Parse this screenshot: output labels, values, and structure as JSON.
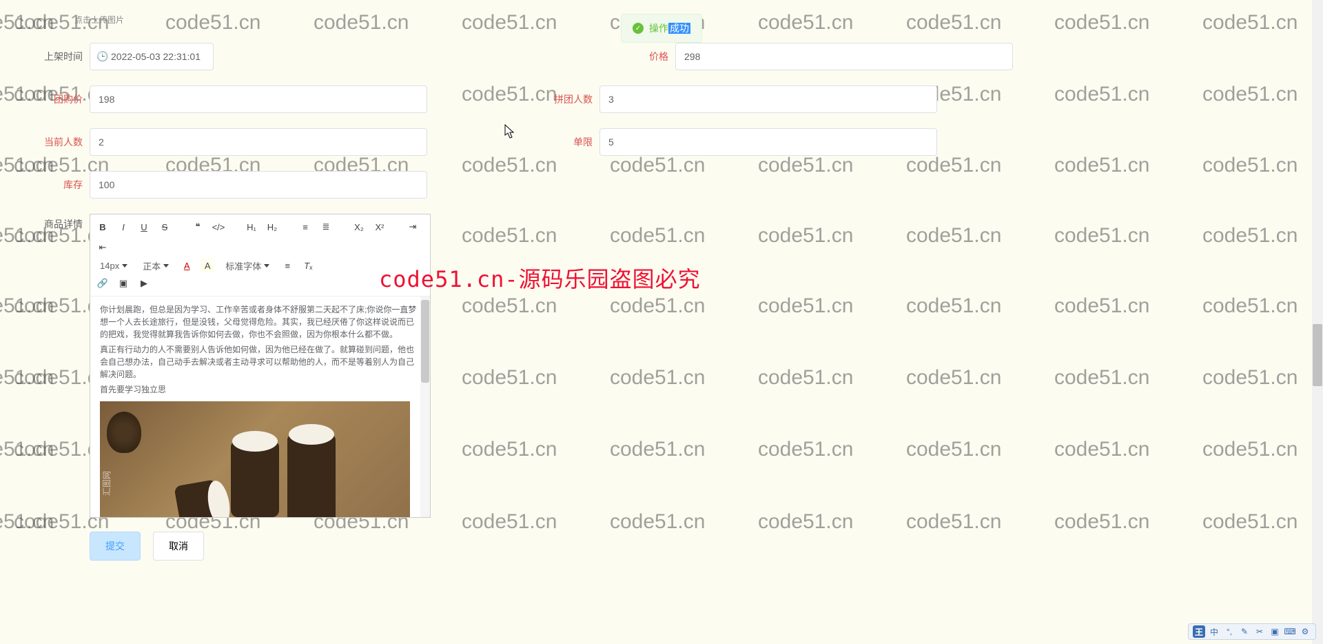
{
  "watermark_text": "code51.cn",
  "big_overlay": "code51.cn-源码乐园盗图必究",
  "toast": {
    "prefix": "操作",
    "highlight": "成功"
  },
  "upload_hint": "点击上传图片",
  "fields": {
    "publish_time": {
      "label": "上架时间",
      "value": "2022-05-03 22:31:01"
    },
    "price": {
      "label": "价格",
      "value": "298"
    },
    "group_price": {
      "label": "团购价",
      "value": "198"
    },
    "group_people": {
      "label": "拼团人数",
      "value": "3"
    },
    "current_people": {
      "label": "当前人数",
      "value": "2"
    },
    "single_limit": {
      "label": "单限",
      "value": "5"
    },
    "stock": {
      "label": "库存",
      "value": "100"
    },
    "detail_label": "商品详情"
  },
  "editor_toolbar": {
    "font_size": "14px",
    "font_style": "正本",
    "font_family": "标准字体"
  },
  "editor_content": {
    "p1": "你计划晨跑，但总是因为学习、工作辛苦或者身体不舒服第二天起不了床;你说你一直梦想一个人去长途旅行，但是没钱，父母觉得危险。其实，我已经厌倦了你这样说说而已的把戏，我觉得就算我告诉你如何去做，你也不会照做，因为你根本什么都不做。",
    "p2": "真正有行动力的人不需要别人告诉他如何做，因为他已经在做了。就算碰到问题，他也会自己想办法，自己动手去解决或者主动寻求可以帮助他的人，而不是等着别人为自己解决问题。",
    "p3": "首先要学习独立思"
  },
  "image_watermark": "汇图网",
  "actions": {
    "submit": "提交",
    "cancel": "取消"
  },
  "ime": [
    "王",
    "中",
    "°,",
    "✎",
    "✂",
    "▣",
    "⌨",
    "⚙"
  ]
}
